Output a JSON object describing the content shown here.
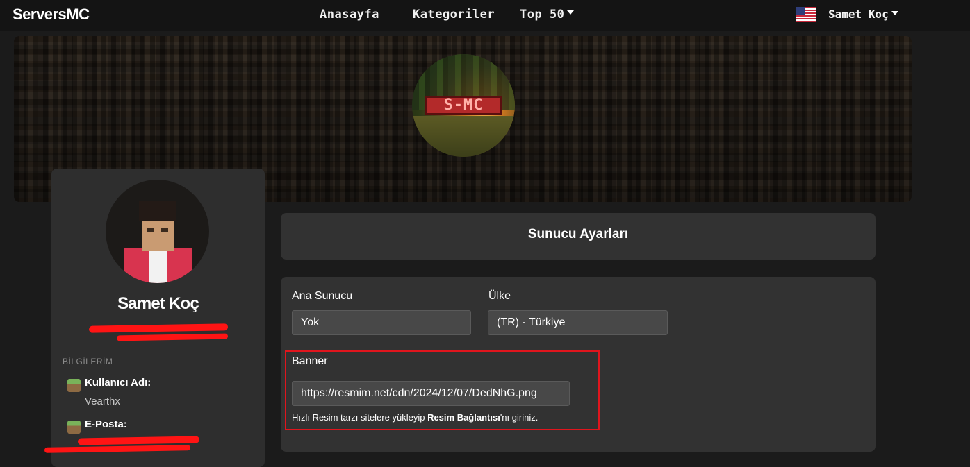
{
  "nav": {
    "brand": "ServersMC",
    "links": [
      "Anasayfa",
      "Kategoriler",
      "Top 50"
    ],
    "user": "Samet Koç",
    "flag_icon": "us-flag-icon"
  },
  "server": {
    "logo_text": "S-MC"
  },
  "profile": {
    "name": "Samet Koç",
    "section_title": "BİLGİLERİM",
    "username_label": "Kullanıcı Adı:",
    "username_value": "Vearthx",
    "email_label": "E-Posta:",
    "info_icon": "grass-block-icon"
  },
  "settings": {
    "title": "Sunucu Ayarları",
    "main_server_label": "Ana Sunucu",
    "main_server_value": "Yok",
    "country_label": "Ülke",
    "country_value": "(TR) - Türkiye",
    "banner_label": "Banner",
    "banner_value": "https://resmim.net/cdn/2024/12/07/DedNhG.png",
    "help_prefix": "Hızlı Resim tarzı sitelere yükleyip ",
    "help_bold": "Resim Bağlantısı",
    "help_suffix": "'nı giriniz."
  },
  "colors": {
    "highlight": "#e0151d",
    "redaction": "#ff1414"
  }
}
